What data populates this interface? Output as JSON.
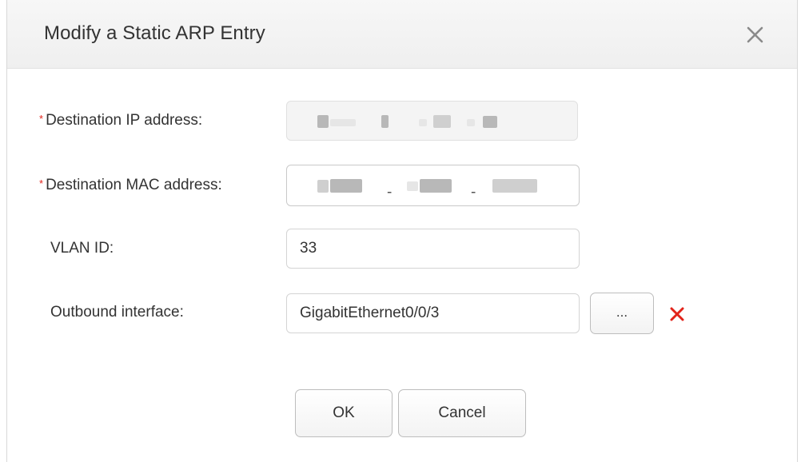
{
  "dialog": {
    "title": "Modify a Static ARP Entry",
    "close_icon": "close-icon"
  },
  "form": {
    "required_marker": "*",
    "dest_ip": {
      "label": "Destination IP address:",
      "value_redacted": true
    },
    "dest_mac": {
      "label": "Destination MAC address:",
      "separator": "-",
      "value_redacted": true
    },
    "vlan_id": {
      "label": "VLAN ID:",
      "value": "33"
    },
    "outbound_interface": {
      "label": "Outbound interface:",
      "value": "GigabitEthernet0/0/3",
      "browse_label": "...",
      "clear_icon": "clear-x-icon"
    }
  },
  "buttons": {
    "ok": "OK",
    "cancel": "Cancel"
  },
  "colors": {
    "required": "#e2231a",
    "clear_icon": "#e2231a",
    "titlebar": "#f2f2f2"
  }
}
